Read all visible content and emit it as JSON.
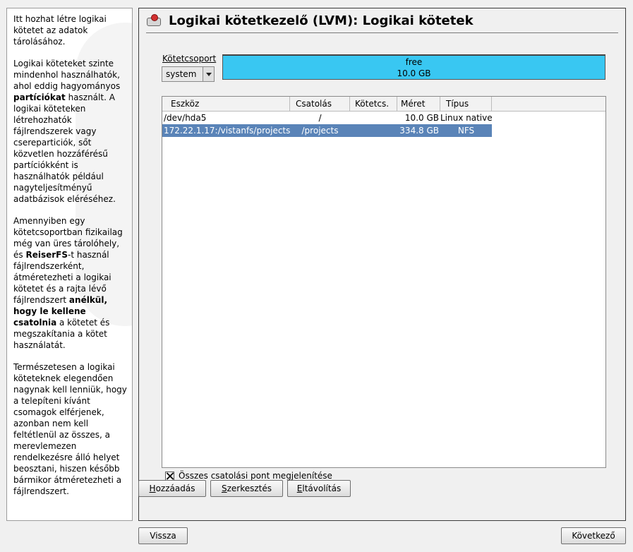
{
  "help": {
    "paragraphs": [
      [
        {
          "t": "Itt hozhat létre logikai kötetet az adatok tárolásához."
        }
      ],
      [
        {
          "t": "Logikai köteteket szinte mindenhol használhatók, ahol eddig hagyományos "
        },
        {
          "t": "partíciókat",
          "b": true
        },
        {
          "t": " használt. A logikai köteteken létrehozhatók fájlrendszerek vagy csereparticiók, sőt közvetlen hozzáférésű partíciókként is használhatók például nagyteljesítményű adatbázisok eléréséhez."
        }
      ],
      [
        {
          "t": "Amennyiben egy kötetcsoportban fizikailag még van üres tárolóhely, és "
        },
        {
          "t": "ReiserFS",
          "b": true
        },
        {
          "t": "-t használ fájlrendszerként, átméretezheti a logikai kötetet és a rajta lévő fájlrendszert "
        },
        {
          "t": "anélkül, hogy le kellene csatolnia",
          "b": true
        },
        {
          "t": " a kötetet és megszakítania a kötet használatát."
        }
      ],
      [
        {
          "t": "Természetesen a logikai köteteknek elegendően nagynak kell lenniük, hogy a telepíteni kívánt csomagok elférjenek, azonban nem kell feltétlenül az összes, a merevlemezen rendelkezésre álló helyet beosztani, hiszen később bármikor átméretezheti a fájlrendszert."
        }
      ]
    ]
  },
  "header": {
    "title": "Logikai kötetkezelő (LVM): Logikai kötetek"
  },
  "volume_group": {
    "label": "Kötetcsoport",
    "selected": "system",
    "free_label": "free",
    "free_size": "10.0 GB",
    "bar_color": "#39c7f2"
  },
  "table": {
    "columns": [
      "Eszköz",
      "Csatolás",
      "Kötetcs.",
      "Méret",
      "Típus"
    ],
    "rows": [
      {
        "device": "/dev/hda5",
        "mount": "/",
        "vg": "",
        "size": "10.0 GB",
        "type": "Linux native",
        "selected": false
      },
      {
        "device": "172.22.1.17:/vistanfs/projects",
        "mount": "/projects",
        "vg": "",
        "size": "334.8 GB",
        "type": "NFS",
        "selected": true
      }
    ],
    "selection_color": "#5a84b8"
  },
  "show_all_mounts": {
    "label": "Összes csatolási pont megjelenítése",
    "checked": true
  },
  "buttons": {
    "add": "Hozzáadás",
    "edit": "Szerkesztés",
    "remove": "Eltávolítás",
    "back": "Vissza",
    "next": "Következő"
  }
}
